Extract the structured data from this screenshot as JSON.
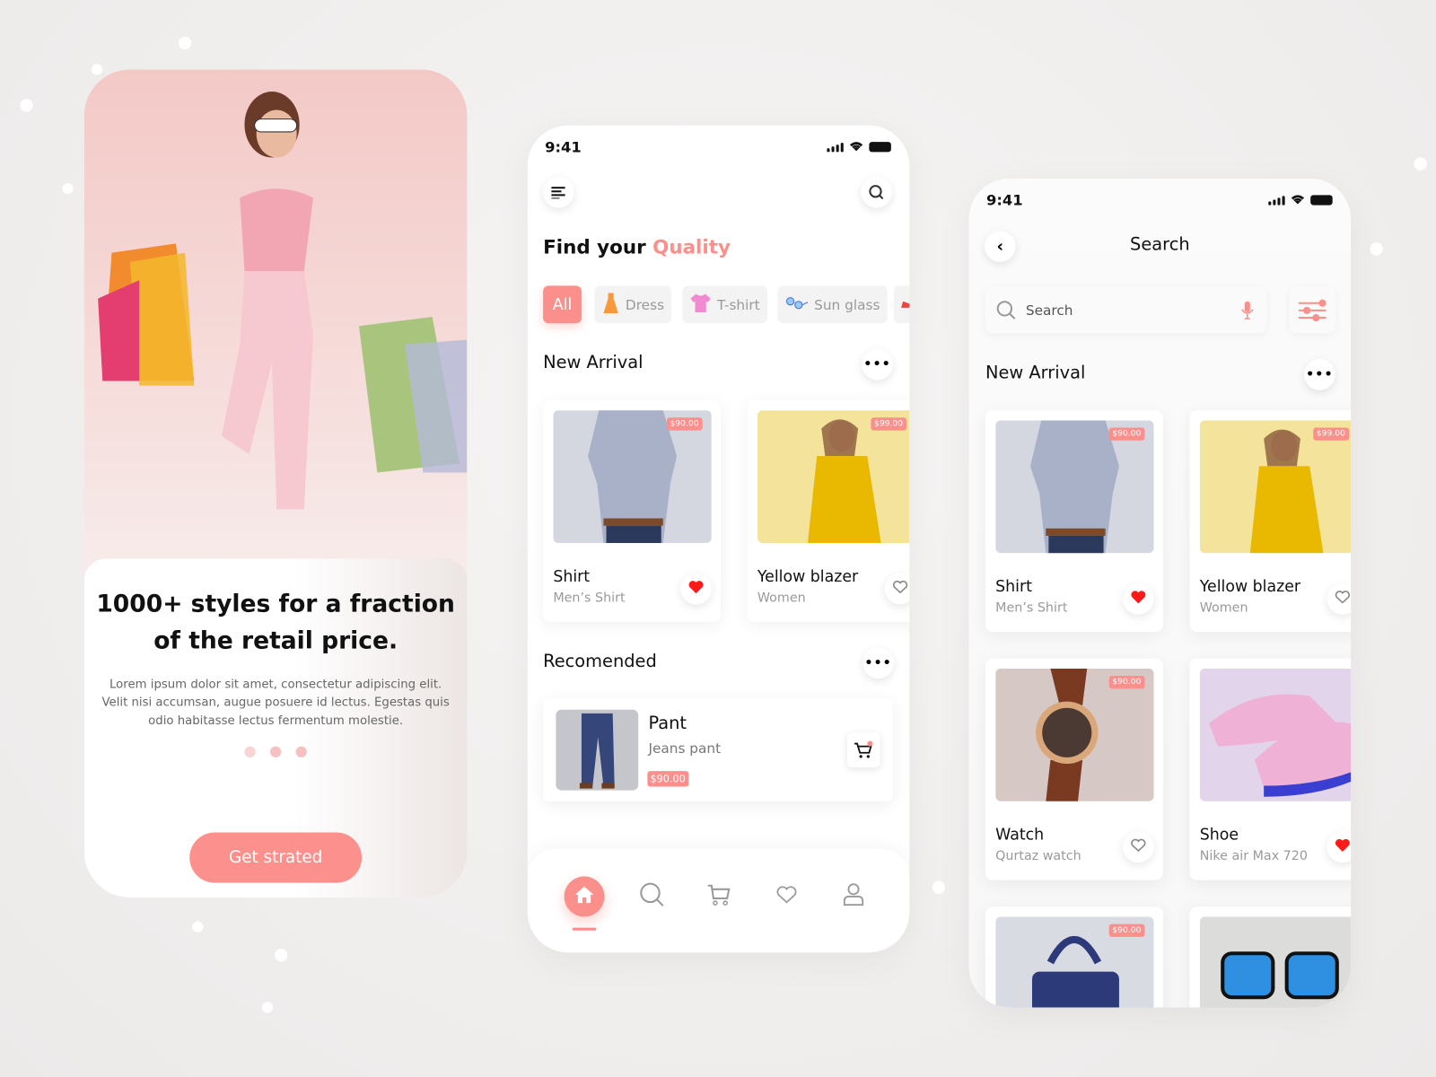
{
  "colors": {
    "accent": "#fb8f8c",
    "heart": "#ff1a1a",
    "background": "#efedec"
  },
  "onboarding": {
    "headline": "1000+ styles for a fraction of the retail price.",
    "body": "Lorem ipsum dolor sit amet, consectetur adipiscing elit. Velit nisi accumsan, augue posuere id lectus. Egestas quis odio habitasse lectus fermentum molestie.",
    "page_count": 3,
    "cta_label": "Get strated"
  },
  "home": {
    "status_time": "9:41",
    "title_prefix": "Find your",
    "title_accent": "Quality",
    "categories": [
      {
        "label": "All",
        "icon": "",
        "active": true
      },
      {
        "label": "Dress",
        "icon": "dress-icon"
      },
      {
        "label": "T-shirt",
        "icon": "tshirt-icon"
      },
      {
        "label": "Sun glass",
        "icon": "sunglass-icon"
      },
      {
        "label": "",
        "icon": "shoe-icon"
      }
    ],
    "new_arrival_title": "New Arrival",
    "new_arrivals": [
      {
        "name": "Shirt",
        "subtitle": "Men’s Shirt",
        "price": "$90.00",
        "favorite": true,
        "image": "shirt"
      },
      {
        "name": "Yellow blazer",
        "subtitle": "Women",
        "price": "$99.00",
        "favorite": false,
        "image": "blazer"
      }
    ],
    "recommended_title": "Recomended",
    "recommended": [
      {
        "name": "Pant",
        "subtitle": "Jeans pant",
        "price": "$90.00",
        "image": "pant"
      }
    ],
    "nav": [
      {
        "name": "home",
        "icon": "home-icon",
        "active": true
      },
      {
        "name": "search",
        "icon": "search-icon"
      },
      {
        "name": "cart",
        "icon": "cart-icon"
      },
      {
        "name": "favorites",
        "icon": "heart-icon"
      },
      {
        "name": "profile",
        "icon": "user-icon"
      }
    ]
  },
  "search": {
    "status_time": "9:41",
    "title": "Search",
    "placeholder": "Search",
    "new_arrival_title": "New Arrival",
    "products": [
      {
        "name": "Shirt",
        "subtitle": "Men’s Shirt",
        "price": "$90.00",
        "favorite": true,
        "image": "shirt"
      },
      {
        "name": "Yellow blazer",
        "subtitle": "Women",
        "price": "$99.00",
        "favorite": false,
        "image": "blazer"
      },
      {
        "name": "Watch",
        "subtitle": "Qurtaz watch",
        "price": "$90.00",
        "favorite": false,
        "image": "watch"
      },
      {
        "name": "Shoe",
        "subtitle": "Nike air Max 720",
        "price": "",
        "favorite": true,
        "image": "shoe"
      },
      {
        "name": "",
        "subtitle": "",
        "price": "$90.00",
        "favorite": false,
        "image": "bag"
      },
      {
        "name": "",
        "subtitle": "",
        "price": "",
        "favorite": false,
        "image": "sunglass"
      }
    ]
  }
}
